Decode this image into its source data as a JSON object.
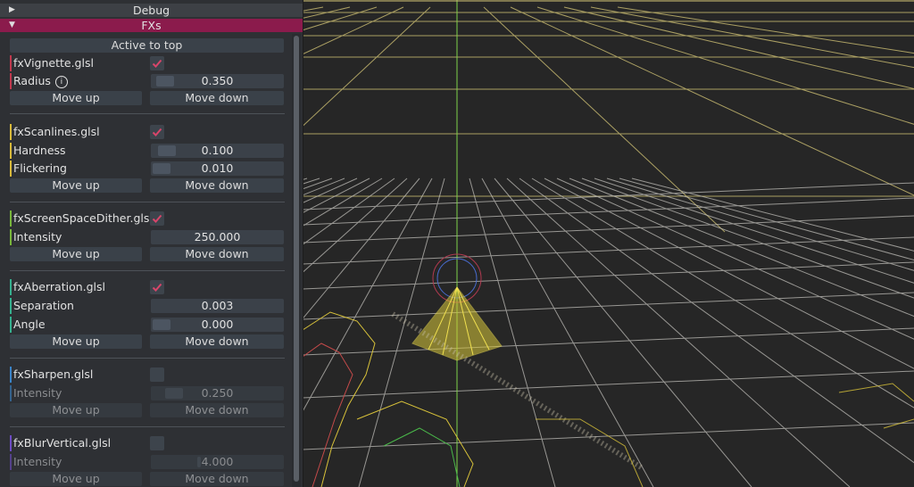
{
  "headers": {
    "debug": "Debug",
    "fxs": "FXs"
  },
  "active_to_top": "Active to top",
  "move_up": "Move up",
  "move_down": "Move down",
  "colors": {
    "fxVignette": "#c0394e",
    "fxScanlines": "#d8b93a",
    "fxScreenSpaceDither": "#78b63b",
    "fxAberration": "#36b08f",
    "fxSharpen": "#3b84c8",
    "fxBlurVertical": "#6e4cc4"
  },
  "fx": {
    "vignette": {
      "name": "fxVignette.glsl",
      "enabled": true,
      "params": [
        {
          "label": "Radius",
          "value": "0.350"
        }
      ]
    },
    "scanlines": {
      "name": "fxScanlines.glsl",
      "enabled": true,
      "params": [
        {
          "label": "Hardness",
          "value": "0.100"
        },
        {
          "label": "Flickering",
          "value": "0.010"
        }
      ]
    },
    "dither": {
      "name": "fxScreenSpaceDither.glsl",
      "enabled": true,
      "params": [
        {
          "label": "Intensity",
          "value": "250.000"
        }
      ]
    },
    "aberration": {
      "name": "fxAberration.glsl",
      "enabled": true,
      "params": [
        {
          "label": "Separation",
          "value": "0.003"
        },
        {
          "label": "Angle",
          "value": "0.000"
        }
      ]
    },
    "sharpen": {
      "name": "fxSharpen.glsl",
      "enabled": false,
      "params": [
        {
          "label": "Intensity",
          "value": "0.250"
        }
      ]
    },
    "blur": {
      "name": "fxBlurVertical.glsl",
      "enabled": false,
      "params": [
        {
          "label": "Intensity",
          "value": "4.000"
        }
      ]
    }
  }
}
